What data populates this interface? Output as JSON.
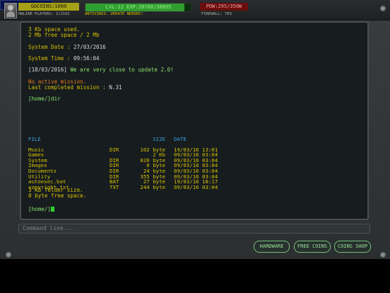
{
  "header": {
    "coins": "GGCOINS:1060",
    "online_players": "ONLINE PLAYERS: 1/2162",
    "level_exp": "LVL:12  EXP:28780/30895",
    "level_progress": 0.93,
    "antivirus": "ANTIVIRUS: UPDATE NEEDED!",
    "power": "POW:295/350W",
    "firewall": "FIREWALL: YES"
  },
  "terminal": {
    "line1": "3 Kb space used.",
    "line2": "2 Mb free space / 2 Mb",
    "date_label": "System Date : ",
    "date_value": "27/03/2016",
    "time_label": "System Time : ",
    "time_value": "09:56:04",
    "news_date": "[18/03/2016]",
    "news_text": " We are very close to update 2.0!",
    "no_mission": "No active mission.",
    "last_mission_label": "Last completed mission : ",
    "last_mission_value": "N.31",
    "command": "[home/]dir",
    "columns": {
      "file": "FILE",
      "size": "SIZE",
      "date": "DATE"
    },
    "files": [
      {
        "name": "Music",
        "type": "DIR",
        "size": "102 byte",
        "date": "19/03/16 13:01"
      },
      {
        "name": "Games",
        "type": "",
        "size": "2 Kb",
        "date": "09/03/16 03:04"
      },
      {
        "name": "System",
        "type": "DIR",
        "size": "820 byte",
        "date": "09/03/16 03:04"
      },
      {
        "name": "Images",
        "type": "DIR",
        "size": "0 byte",
        "date": "09/03/16 03:04"
      },
      {
        "name": "Documents",
        "type": "DIR",
        "size": "24 byte",
        "date": "09/03/16 03:04"
      },
      {
        "name": "Utility",
        "type": "DIR",
        "size": "355 byte",
        "date": "09/03/16 03:04"
      },
      {
        "name": "autoexec.bat",
        "type": "BAT",
        "size": "27 byte",
        "date": "19/03/16 18:17"
      },
      {
        "name": "copyright.txt",
        "type": "TXT",
        "size": "244 byte",
        "date": "09/03/16 03:04"
      }
    ],
    "folder_size": "3 Kb folder size.",
    "free_space": "0 byte free space.",
    "prompt": "[home/]"
  },
  "command_line": {
    "placeholder": "Command line..."
  },
  "buttons": {
    "hardware": "HARDWARE",
    "free_coins": "FREE COINS",
    "coins_shop": "COINS SHOP"
  },
  "colors": {
    "terminal_text": "#d5c200",
    "terminal_green": "#8be36c",
    "terminal_orange": "#e77a17",
    "terminal_blue": "#3ca0d8",
    "button_green": "#74c07a"
  }
}
